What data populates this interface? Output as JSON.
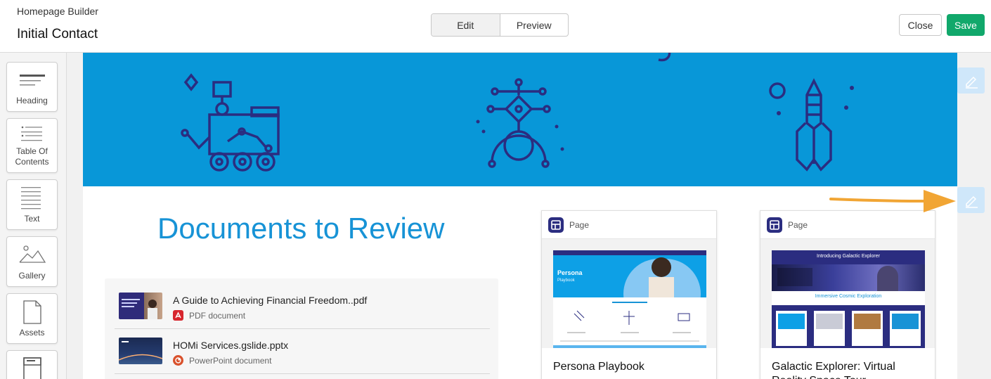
{
  "header": {
    "app_name": "Homepage Builder",
    "page_title": "Initial Contact",
    "mode_tabs": [
      {
        "label": "Edit",
        "active": true
      },
      {
        "label": "Preview",
        "active": false
      }
    ],
    "close_label": "Close",
    "save_label": "Save"
  },
  "sidebar": {
    "tools": [
      {
        "label": "Heading",
        "icon": "heading-icon"
      },
      {
        "label": "Table Of Contents",
        "icon": "table-of-contents-icon"
      },
      {
        "label": "Text",
        "icon": "text-icon"
      },
      {
        "label": "Gallery",
        "icon": "gallery-icon"
      },
      {
        "label": "Assets",
        "icon": "document-icon"
      }
    ]
  },
  "content": {
    "documents_heading": "Documents to Review",
    "documents": [
      {
        "name": "A Guide to Achieving Financial Freedom..pdf",
        "type": "PDF document",
        "type_color": "#d7262e"
      },
      {
        "name": "HOMi Services.gslide.pptx",
        "type": "PowerPoint document",
        "type_color": "#d9512c"
      }
    ],
    "cards": [
      {
        "type": "Page",
        "title": "Persona Playbook",
        "thumb_heading": "Persona",
        "thumb_sub": "Playbook"
      },
      {
        "type": "Page",
        "title": "Galactic Explorer: Virtual Reality Space Tour",
        "thumb_heading": "Introducing Galactic Explorer",
        "thumb_sub": "Immersive Cosmic Exploration"
      }
    ]
  },
  "colors": {
    "accent_blue": "#1793d6",
    "banner_blue": "#0897d8",
    "icon_navy": "#2b2d80",
    "save_green": "#11a86b"
  }
}
